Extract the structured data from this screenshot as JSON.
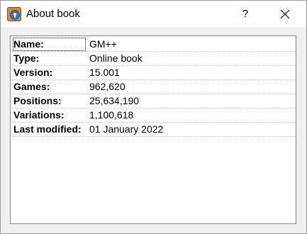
{
  "window": {
    "title": "About book",
    "help_label": "?",
    "app_icon": "book-icon",
    "close_icon": "close-icon"
  },
  "properties": [
    {
      "key": "Name:",
      "value": "GM++"
    },
    {
      "key": "Type:",
      "value": "Online book"
    },
    {
      "key": "Version:",
      "value": "15.001"
    },
    {
      "key": "Games:",
      "value": "962,620"
    },
    {
      "key": "Positions:",
      "value": "25,634,190"
    },
    {
      "key": "Variations:",
      "value": "1,100,618"
    },
    {
      "key": "Last modified:",
      "value": "01 January 2022"
    }
  ]
}
